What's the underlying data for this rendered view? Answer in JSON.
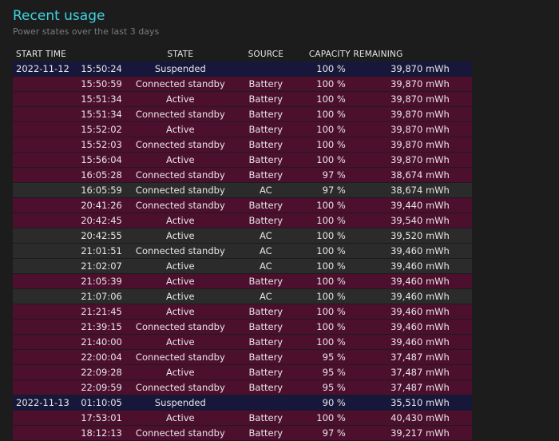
{
  "header": {
    "title": "Recent usage",
    "subtitle": "Power states over the last 3 days"
  },
  "columns": {
    "start_time": "START TIME",
    "state": "STATE",
    "source": "SOURCE",
    "capacity": "CAPACITY REMAINING"
  },
  "colors": {
    "title": "#3fd3e0",
    "battery_row": "#4d0f2e",
    "ac_row": "#2b2b2b",
    "suspended_row": "#16173a"
  },
  "rows": [
    {
      "date": "2022-11-12",
      "time": "15:50:24",
      "state": "Suspended",
      "source": "",
      "percent": "100 %",
      "capacity": "39,870 mWh",
      "kind": "susp"
    },
    {
      "date": "",
      "time": "15:50:59",
      "state": "Connected standby",
      "source": "Battery",
      "percent": "100 %",
      "capacity": "39,870 mWh",
      "kind": "batt"
    },
    {
      "date": "",
      "time": "15:51:34",
      "state": "Active",
      "source": "Battery",
      "percent": "100 %",
      "capacity": "39,870 mWh",
      "kind": "batt"
    },
    {
      "date": "",
      "time": "15:51:34",
      "state": "Connected standby",
      "source": "Battery",
      "percent": "100 %",
      "capacity": "39,870 mWh",
      "kind": "batt"
    },
    {
      "date": "",
      "time": "15:52:02",
      "state": "Active",
      "source": "Battery",
      "percent": "100 %",
      "capacity": "39,870 mWh",
      "kind": "batt"
    },
    {
      "date": "",
      "time": "15:52:03",
      "state": "Connected standby",
      "source": "Battery",
      "percent": "100 %",
      "capacity": "39,870 mWh",
      "kind": "batt"
    },
    {
      "date": "",
      "time": "15:56:04",
      "state": "Active",
      "source": "Battery",
      "percent": "100 %",
      "capacity": "39,870 mWh",
      "kind": "batt"
    },
    {
      "date": "",
      "time": "16:05:28",
      "state": "Connected standby",
      "source": "Battery",
      "percent": "97 %",
      "capacity": "38,674 mWh",
      "kind": "batt"
    },
    {
      "date": "",
      "time": "16:05:59",
      "state": "Connected standby",
      "source": "AC",
      "percent": "97 %",
      "capacity": "38,674 mWh",
      "kind": "ac"
    },
    {
      "date": "",
      "time": "20:41:26",
      "state": "Connected standby",
      "source": "Battery",
      "percent": "100 %",
      "capacity": "39,440 mWh",
      "kind": "batt"
    },
    {
      "date": "",
      "time": "20:42:45",
      "state": "Active",
      "source": "Battery",
      "percent": "100 %",
      "capacity": "39,540 mWh",
      "kind": "batt"
    },
    {
      "date": "",
      "time": "20:42:55",
      "state": "Active",
      "source": "AC",
      "percent": "100 %",
      "capacity": "39,520 mWh",
      "kind": "ac"
    },
    {
      "date": "",
      "time": "21:01:51",
      "state": "Connected standby",
      "source": "AC",
      "percent": "100 %",
      "capacity": "39,460 mWh",
      "kind": "ac"
    },
    {
      "date": "",
      "time": "21:02:07",
      "state": "Active",
      "source": "AC",
      "percent": "100 %",
      "capacity": "39,460 mWh",
      "kind": "ac"
    },
    {
      "date": "",
      "time": "21:05:39",
      "state": "Active",
      "source": "Battery",
      "percent": "100 %",
      "capacity": "39,460 mWh",
      "kind": "batt"
    },
    {
      "date": "",
      "time": "21:07:06",
      "state": "Active",
      "source": "AC",
      "percent": "100 %",
      "capacity": "39,460 mWh",
      "kind": "ac"
    },
    {
      "date": "",
      "time": "21:21:45",
      "state": "Active",
      "source": "Battery",
      "percent": "100 %",
      "capacity": "39,460 mWh",
      "kind": "batt"
    },
    {
      "date": "",
      "time": "21:39:15",
      "state": "Connected standby",
      "source": "Battery",
      "percent": "100 %",
      "capacity": "39,460 mWh",
      "kind": "batt"
    },
    {
      "date": "",
      "time": "21:40:00",
      "state": "Active",
      "source": "Battery",
      "percent": "100 %",
      "capacity": "39,460 mWh",
      "kind": "batt"
    },
    {
      "date": "",
      "time": "22:00:04",
      "state": "Connected standby",
      "source": "Battery",
      "percent": "95 %",
      "capacity": "37,487 mWh",
      "kind": "batt"
    },
    {
      "date": "",
      "time": "22:09:28",
      "state": "Active",
      "source": "Battery",
      "percent": "95 %",
      "capacity": "37,487 mWh",
      "kind": "batt"
    },
    {
      "date": "",
      "time": "22:09:59",
      "state": "Connected standby",
      "source": "Battery",
      "percent": "95 %",
      "capacity": "37,487 mWh",
      "kind": "batt"
    },
    {
      "date": "2022-11-13",
      "time": "01:10:05",
      "state": "Suspended",
      "source": "",
      "percent": "90 %",
      "capacity": "35,510 mWh",
      "kind": "susp"
    },
    {
      "date": "",
      "time": "17:53:01",
      "state": "Active",
      "source": "Battery",
      "percent": "100 %",
      "capacity": "40,430 mWh",
      "kind": "batt"
    },
    {
      "date": "",
      "time": "18:12:13",
      "state": "Connected standby",
      "source": "Battery",
      "percent": "97 %",
      "capacity": "39,217 mWh",
      "kind": "batt"
    }
  ]
}
